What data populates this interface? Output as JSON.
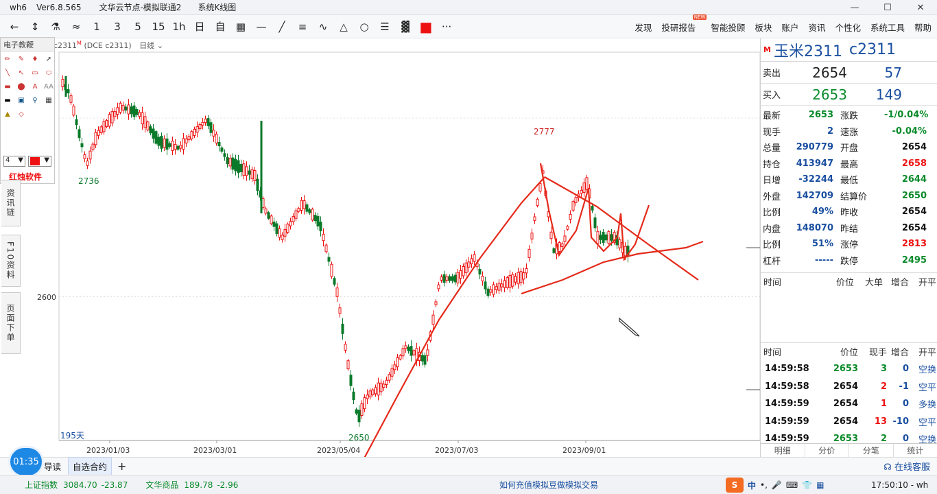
{
  "titlebar": {
    "app": "wh6",
    "version": "Ver6.8.565",
    "node": "文华云节点-模拟联通2",
    "view": "系统K线图"
  },
  "window_controls": [
    "—",
    "☐",
    "✕"
  ],
  "toolbar": {
    "left_items": [
      "←",
      "↕",
      "⚗",
      "≈",
      "1",
      "3",
      "5",
      "15",
      "1h",
      "日",
      "自",
      "▦",
      "—",
      "╱",
      "≡",
      "∿",
      "△",
      "○",
      "☰",
      "▓",
      "■",
      "···"
    ],
    "right_items": [
      "发现",
      "投研报告",
      "智能投顾",
      "板块",
      "账户",
      "资讯",
      "个性化",
      "系统工具",
      "帮助"
    ],
    "new_badge": "NEW"
  },
  "chart_header": {
    "contract": "c2311",
    "m": "M",
    "code": "(DCE c2311)",
    "period": "日线"
  },
  "drawing_panel": {
    "title": "电子教鞭",
    "width_value": "4",
    "brand": "红烛软件"
  },
  "left_tabs": [
    "资讯链",
    "F10资料",
    "页面下单"
  ],
  "chart_data": {
    "type": "candlestick",
    "x_labels": [
      "2023/01/03",
      "2023/03/01",
      "2023/05/04",
      "2023/07/03",
      "2023/09/01"
    ],
    "y_labels": [
      "2600"
    ],
    "annotations": [
      "2736",
      "2650",
      "2777",
      "195天"
    ],
    "colors": {
      "up": "#e11",
      "down": "#0a7a2a",
      "drawing": "#e52a1a"
    }
  },
  "quote": {
    "m_tag": "M",
    "name": "玉米2311",
    "code": "c2311",
    "sell_label": "卖出",
    "sell_price": "2654",
    "sell_vol": "57",
    "buy_label": "买入",
    "buy_price": "2653",
    "buy_vol": "149",
    "stats": [
      {
        "k": "最新",
        "v": "2653",
        "vc": "green",
        "k2": "涨跌",
        "v2": "-1/0.04%",
        "v2c": "green"
      },
      {
        "k": "现手",
        "v": "2",
        "vc": "blue",
        "k2": "速涨",
        "v2": "-0.04%",
        "v2c": "green"
      },
      {
        "k": "总量",
        "v": "290779",
        "vc": "blue",
        "k2": "开盘",
        "v2": "2654",
        "v2c": "dark"
      },
      {
        "k": "持仓",
        "v": "413947",
        "vc": "blue",
        "k2": "最高",
        "v2": "2658",
        "v2c": "red"
      },
      {
        "k": "日增",
        "v": "-32244",
        "vc": "blue",
        "k2": "最低",
        "v2": "2644",
        "v2c": "green"
      },
      {
        "k": "外盘",
        "v": "142709",
        "vc": "blue",
        "k2": "结算价",
        "v2": "2650",
        "v2c": "green"
      },
      {
        "k": "比例",
        "v": "49%",
        "vc": "blue",
        "k2": "昨收",
        "v2": "2654",
        "v2c": "dark"
      },
      {
        "k": "内盘",
        "v": "148070",
        "vc": "blue",
        "k2": "昨结",
        "v2": "2654",
        "v2c": "dark"
      },
      {
        "k": "比例",
        "v": "51%",
        "vc": "blue",
        "k2": "涨停",
        "v2": "2813",
        "v2c": "red"
      },
      {
        "k": "杠杆",
        "v": "-----",
        "vc": "blue",
        "k2": "跌停",
        "v2": "2495",
        "v2c": "green"
      }
    ],
    "deal_header": [
      "时间",
      "价位",
      "大单",
      "增合",
      "开平"
    ],
    "tick_header": [
      "时间",
      "价位",
      "现手",
      "增合",
      "开平"
    ],
    "ticks": [
      {
        "t": "14:59:58",
        "p": "2653",
        "pc": "green",
        "q": "3",
        "qc": "green",
        "c": "0",
        "ty": "空换"
      },
      {
        "t": "14:59:58",
        "p": "2654",
        "pc": "dark",
        "q": "2",
        "qc": "red",
        "c": "-1",
        "ty": "空平"
      },
      {
        "t": "14:59:59",
        "p": "2654",
        "pc": "dark",
        "q": "1",
        "qc": "red",
        "c": "0",
        "ty": "多换"
      },
      {
        "t": "14:59:59",
        "p": "2654",
        "pc": "dark",
        "q": "13",
        "qc": "red",
        "c": "-10",
        "ty": "空平"
      },
      {
        "t": "14:59:59",
        "p": "2653",
        "pc": "green",
        "q": "2",
        "qc": "green",
        "c": "0",
        "ty": "空换"
      }
    ],
    "tabs": [
      "明细",
      "分价",
      "分笔",
      "统计"
    ]
  },
  "bottom_tabs": [
    "导读",
    "自选合约",
    "+"
  ],
  "online_service": "在线客服",
  "timer": "01:35",
  "status": {
    "idx1_name": "上证指数",
    "idx1_val": "3084.70",
    "idx1_chg": "-23.87",
    "idx2_name": "文华商品",
    "idx2_val": "189.78",
    "idx2_chg": "-2.96",
    "promo": "如何充值模拟豆做模拟交易",
    "clock": "17:50:10 - wh"
  }
}
